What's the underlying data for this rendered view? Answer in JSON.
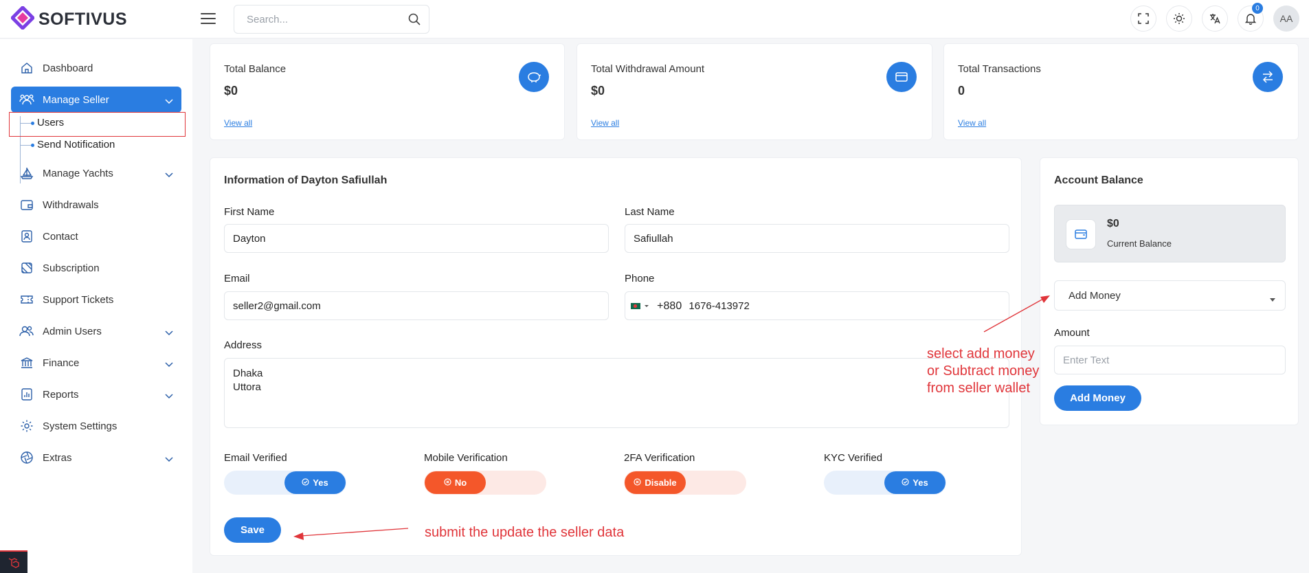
{
  "brand": {
    "name": "SOFTIVUS"
  },
  "search": {
    "placeholder": "Search..."
  },
  "topbar": {
    "notification_count": "0",
    "avatar_initials": "AA"
  },
  "sidebar": {
    "items": [
      {
        "label": "Dashboard"
      },
      {
        "label": "Manage Seller"
      },
      {
        "label": "Manage Yachts"
      },
      {
        "label": "Withdrawals"
      },
      {
        "label": "Contact"
      },
      {
        "label": "Subscription"
      },
      {
        "label": "Support Tickets"
      },
      {
        "label": "Admin Users"
      },
      {
        "label": "Finance"
      },
      {
        "label": "Reports"
      },
      {
        "label": "System Settings"
      },
      {
        "label": "Extras"
      }
    ],
    "sub_items": [
      {
        "label": "Users"
      },
      {
        "label": "Send Notification"
      }
    ]
  },
  "stats": [
    {
      "label": "Total Balance",
      "value": "$0",
      "link": "View all"
    },
    {
      "label": "Total Withdrawal Amount",
      "value": "$0",
      "link": "View all"
    },
    {
      "label": "Total Transactions",
      "value": "0",
      "link": "View all"
    }
  ],
  "info": {
    "title": "Information of Dayton Safiullah",
    "first_name_label": "First Name",
    "first_name": "Dayton",
    "last_name_label": "Last Name",
    "last_name": "Safiullah",
    "email_label": "Email",
    "email": "seller2@gmail.com",
    "phone_label": "Phone",
    "phone_code": "+880",
    "phone": "1676-413972",
    "address_label": "Address",
    "address_line1": "Dhaka",
    "address_line2": "Uttora",
    "toggles": [
      {
        "label": "Email Verified",
        "value": "Yes"
      },
      {
        "label": "Mobile Verification",
        "value": "No"
      },
      {
        "label": "2FA Verification",
        "value": "Disable"
      },
      {
        "label": "KYC Verified",
        "value": "Yes"
      }
    ],
    "save_label": "Save"
  },
  "account": {
    "title": "Account Balance",
    "balance": "$0",
    "balance_caption": "Current Balance",
    "action_selected": "Add Money",
    "amount_label": "Amount",
    "amount_placeholder": "Enter Text",
    "submit_label": "Add Money"
  },
  "annotations": {
    "wallet_note_line1": "select add money",
    "wallet_note_line2": "or Subtract money",
    "wallet_note_line3": "from seller wallet",
    "save_note": "submit the update the seller data"
  },
  "colors": {
    "accent": "#2a7de1",
    "danger": "#f4572a",
    "annotation": "#e0353a"
  }
}
